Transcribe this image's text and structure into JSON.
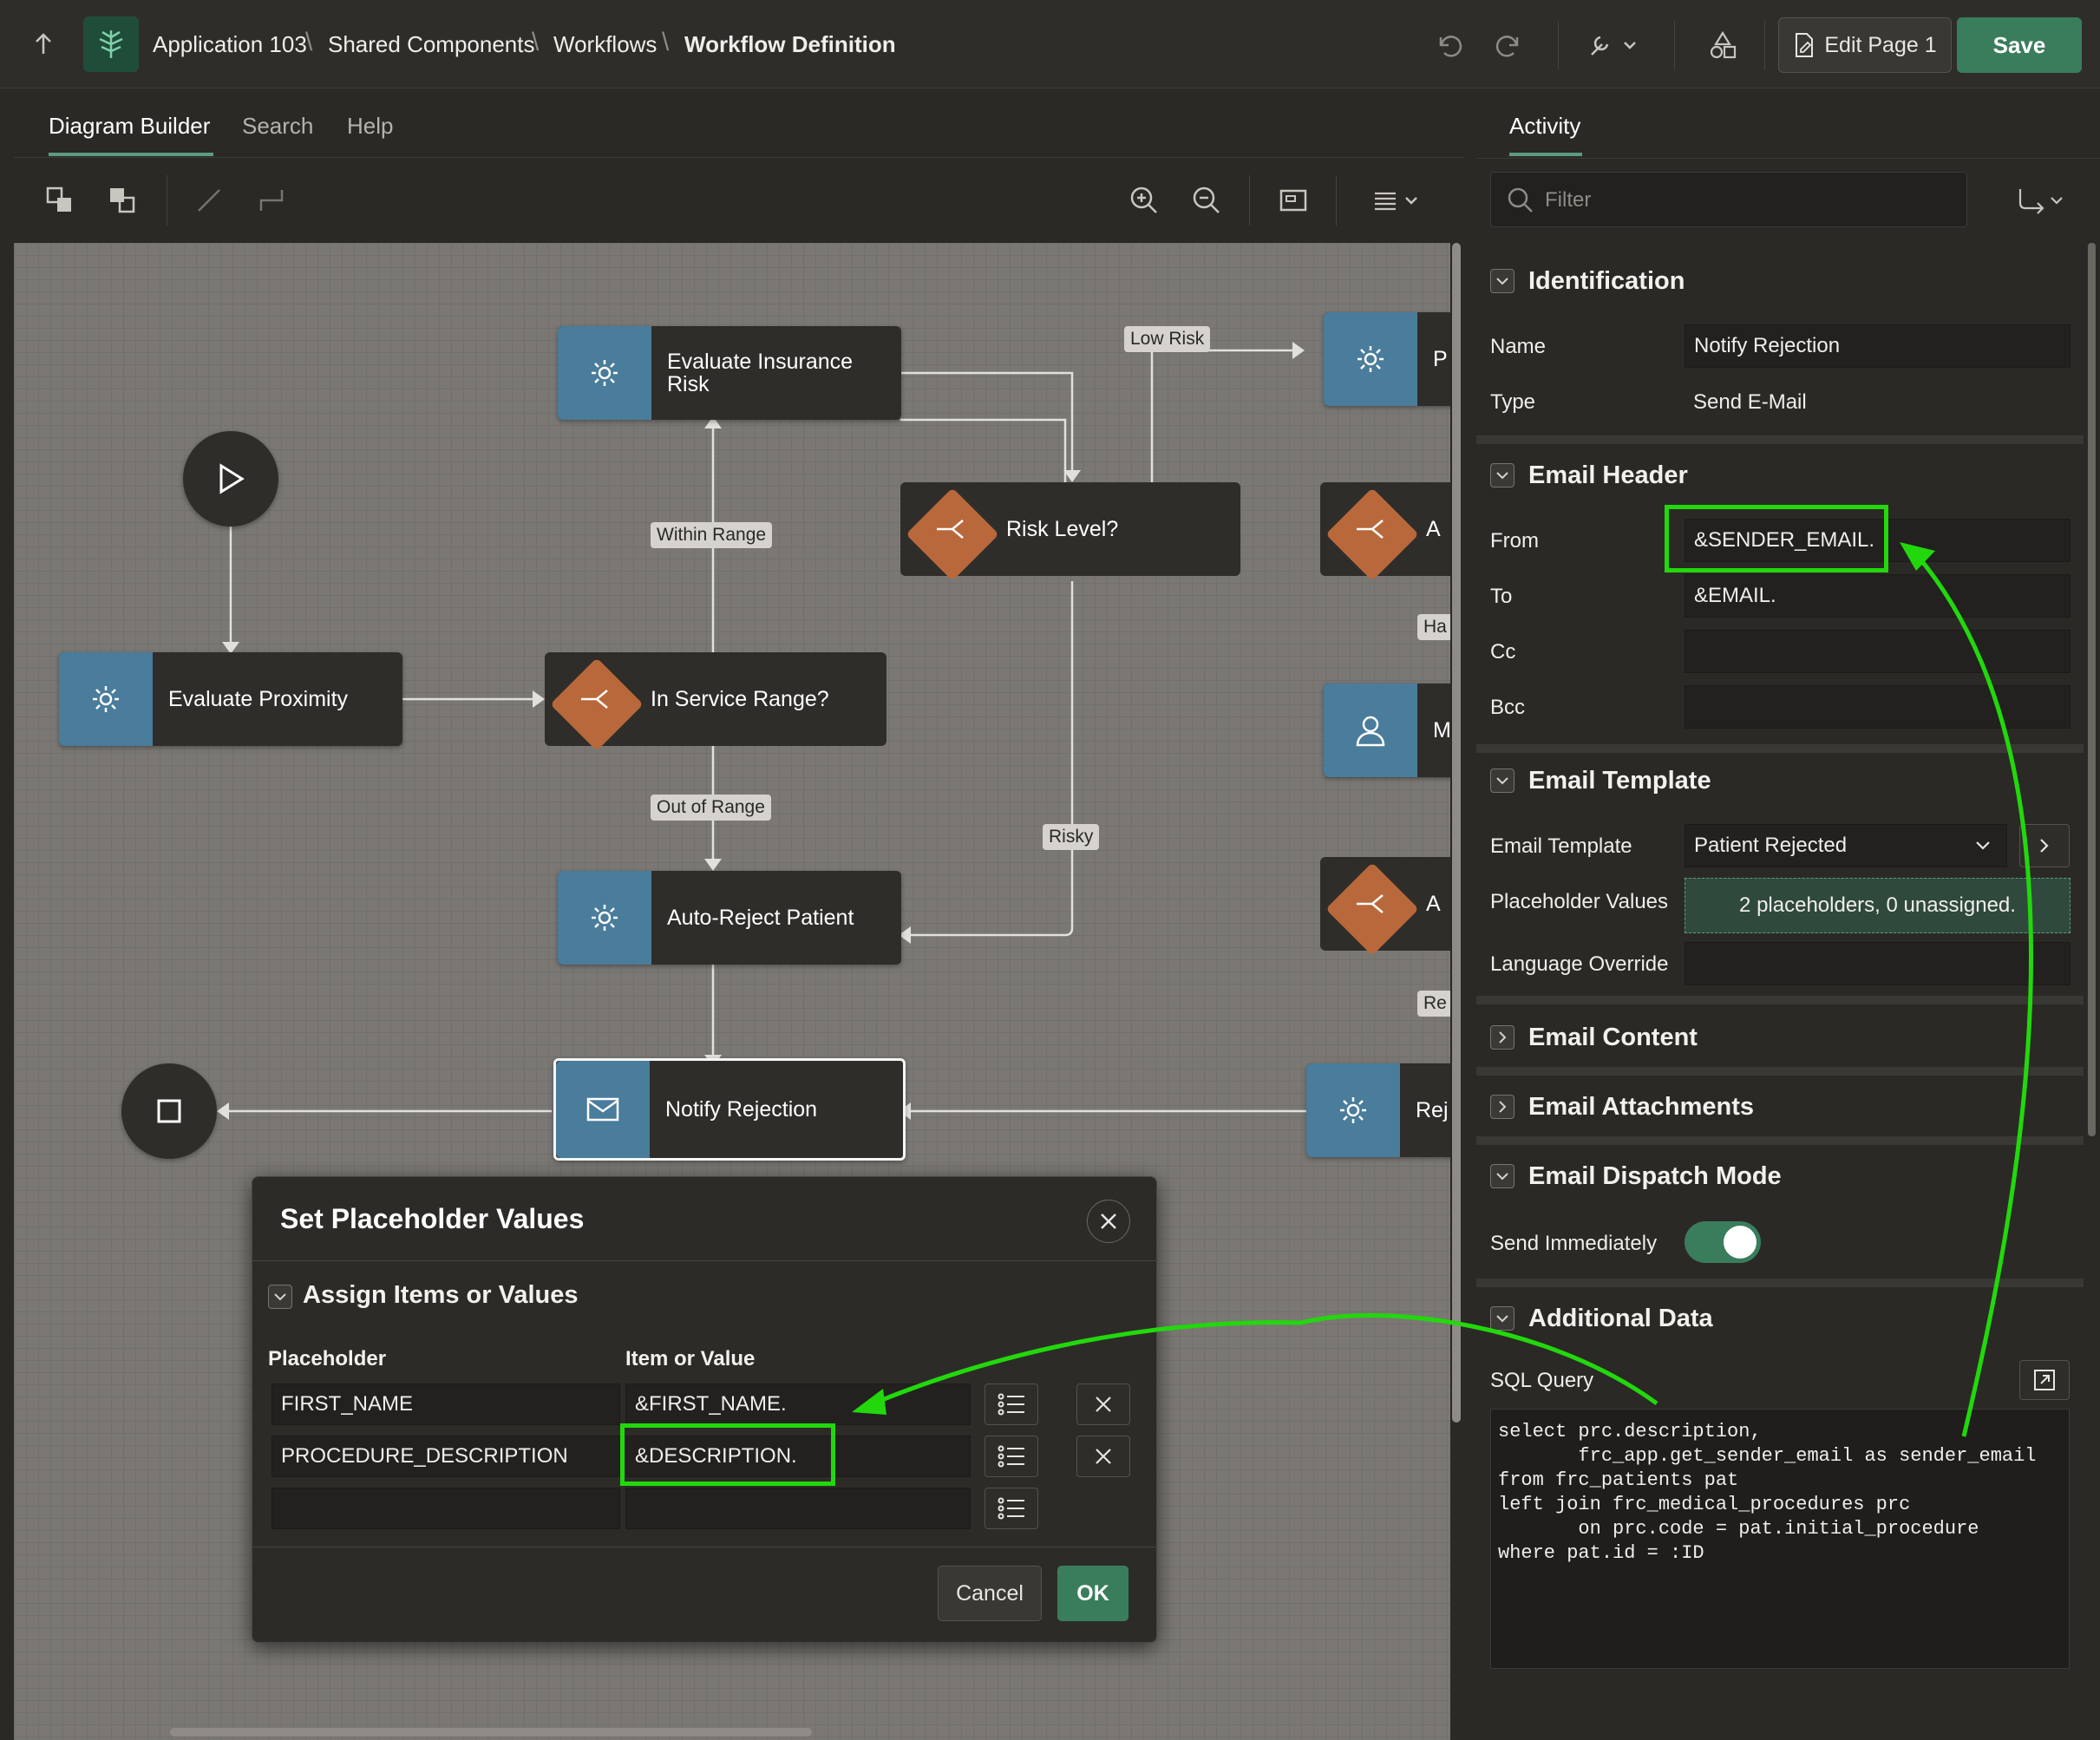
{
  "topbar": {
    "breadcrumbs": [
      "Application 103",
      "Shared Components",
      "Workflows",
      "Workflow Definition"
    ],
    "edit_page_label": "Edit Page 1",
    "save_label": "Save"
  },
  "left_tabs": [
    "Diagram Builder",
    "Search",
    "Help"
  ],
  "diagram": {
    "nodes": {
      "evaluate_insurance_risk": "Evaluate Insurance Risk",
      "risk_level": "Risk Level?",
      "evaluate_proximity": "Evaluate Proximity",
      "in_service_range": "In Service Range?",
      "auto_reject_patient": "Auto-Reject Patient",
      "notify_rejection": "Notify Rejection",
      "partial_p": "P",
      "partial_a1": "A",
      "partial_m": "M",
      "partial_a2": "A",
      "partial_rej": "Rej"
    },
    "edge_labels": {
      "low_risk": "Low Risk",
      "within_range": "Within Range",
      "out_of_range": "Out of Range",
      "risky": "Risky",
      "ha": "Ha",
      "re": "Re"
    }
  },
  "dialog": {
    "title": "Set Placeholder Values",
    "section_title": "Assign Items or Values",
    "col_placeholder": "Placeholder",
    "col_value": "Item or Value",
    "rows": [
      {
        "placeholder": "FIRST_NAME",
        "value": "&FIRST_NAME."
      },
      {
        "placeholder": "PROCEDURE_DESCRIPTION",
        "value": "&DESCRIPTION."
      },
      {
        "placeholder": "",
        "value": ""
      }
    ],
    "cancel_label": "Cancel",
    "ok_label": "OK"
  },
  "right_panel": {
    "tab": "Activity",
    "filter_placeholder": "Filter",
    "identification": {
      "title": "Identification",
      "name_label": "Name",
      "name_value": "Notify Rejection",
      "type_label": "Type",
      "type_value": "Send E-Mail"
    },
    "email_header": {
      "title": "Email Header",
      "from_label": "From",
      "from_value": "&SENDER_EMAIL.",
      "to_label": "To",
      "to_value": "&EMAIL.",
      "cc_label": "Cc",
      "cc_value": "",
      "bcc_label": "Bcc",
      "bcc_value": ""
    },
    "email_template": {
      "title": "Email Template",
      "template_label": "Email Template",
      "template_value": "Patient Rejected",
      "placeholder_label": "Placeholder Values",
      "placeholder_value": "2 placeholders, 0 unassigned.",
      "language_label": "Language Override",
      "language_value": ""
    },
    "email_content": {
      "title": "Email Content"
    },
    "email_attachments": {
      "title": "Email Attachments"
    },
    "email_dispatch": {
      "title": "Email Dispatch Mode",
      "send_immediately_label": "Send Immediately",
      "send_immediately_on": true
    },
    "additional_data": {
      "title": "Additional Data",
      "sql_label": "SQL Query",
      "sql": "select prc.description,\n       frc_app.get_sender_email as sender_email\nfrom frc_patients pat\nleft join frc_medical_procedures prc\n       on prc.code = pat.initial_procedure\nwhere pat.id = :ID"
    }
  },
  "colors": {
    "accent": "#3a7d5c",
    "task": "#4a7c9b",
    "gateway": "#b8683a",
    "highlight": "#22d80c"
  }
}
